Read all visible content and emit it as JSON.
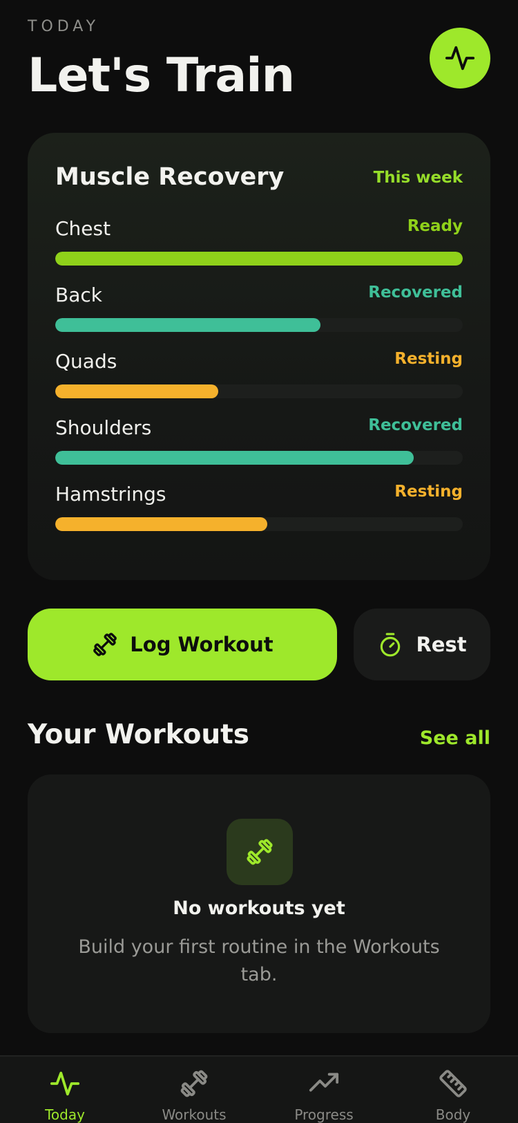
{
  "header": {
    "eyebrow": "TODAY",
    "title": "Let's Train"
  },
  "recovery": {
    "title": "Muscle Recovery",
    "period": "This week",
    "muscles": [
      {
        "name": "Chest",
        "status": "Ready",
        "level": 1.0,
        "color": "#8fd11a",
        "status_color": "#8fd11a"
      },
      {
        "name": "Back",
        "status": "Recovered",
        "level": 0.65,
        "color": "#3fbf98",
        "status_color": "#3fbf98"
      },
      {
        "name": "Quads",
        "status": "Resting",
        "level": 0.4,
        "color": "#f5b12c",
        "status_color": "#f5b12c"
      },
      {
        "name": "Shoulders",
        "status": "Recovered",
        "level": 0.88,
        "color": "#3fbf98",
        "status_color": "#3fbf98"
      },
      {
        "name": "Hamstrings",
        "status": "Resting",
        "level": 0.52,
        "color": "#f5b12c",
        "status_color": "#f5b12c"
      }
    ]
  },
  "actions": {
    "log_workout": "Log Workout",
    "rest": "Rest"
  },
  "workouts": {
    "title": "Your Workouts",
    "see_all": "See all",
    "empty_title": "No workouts yet",
    "empty_desc": "Build your first routine in the Workouts tab."
  },
  "nav": {
    "items": [
      {
        "label": "Today",
        "icon": "pulse-icon",
        "active": true
      },
      {
        "label": "Workouts",
        "icon": "dumbbell-icon",
        "active": false
      },
      {
        "label": "Progress",
        "icon": "trend-up-icon",
        "active": false
      },
      {
        "label": "Body",
        "icon": "ruler-icon",
        "active": false
      }
    ]
  },
  "colors": {
    "accent": "#9ee82b",
    "background": "#0d0d0d"
  }
}
